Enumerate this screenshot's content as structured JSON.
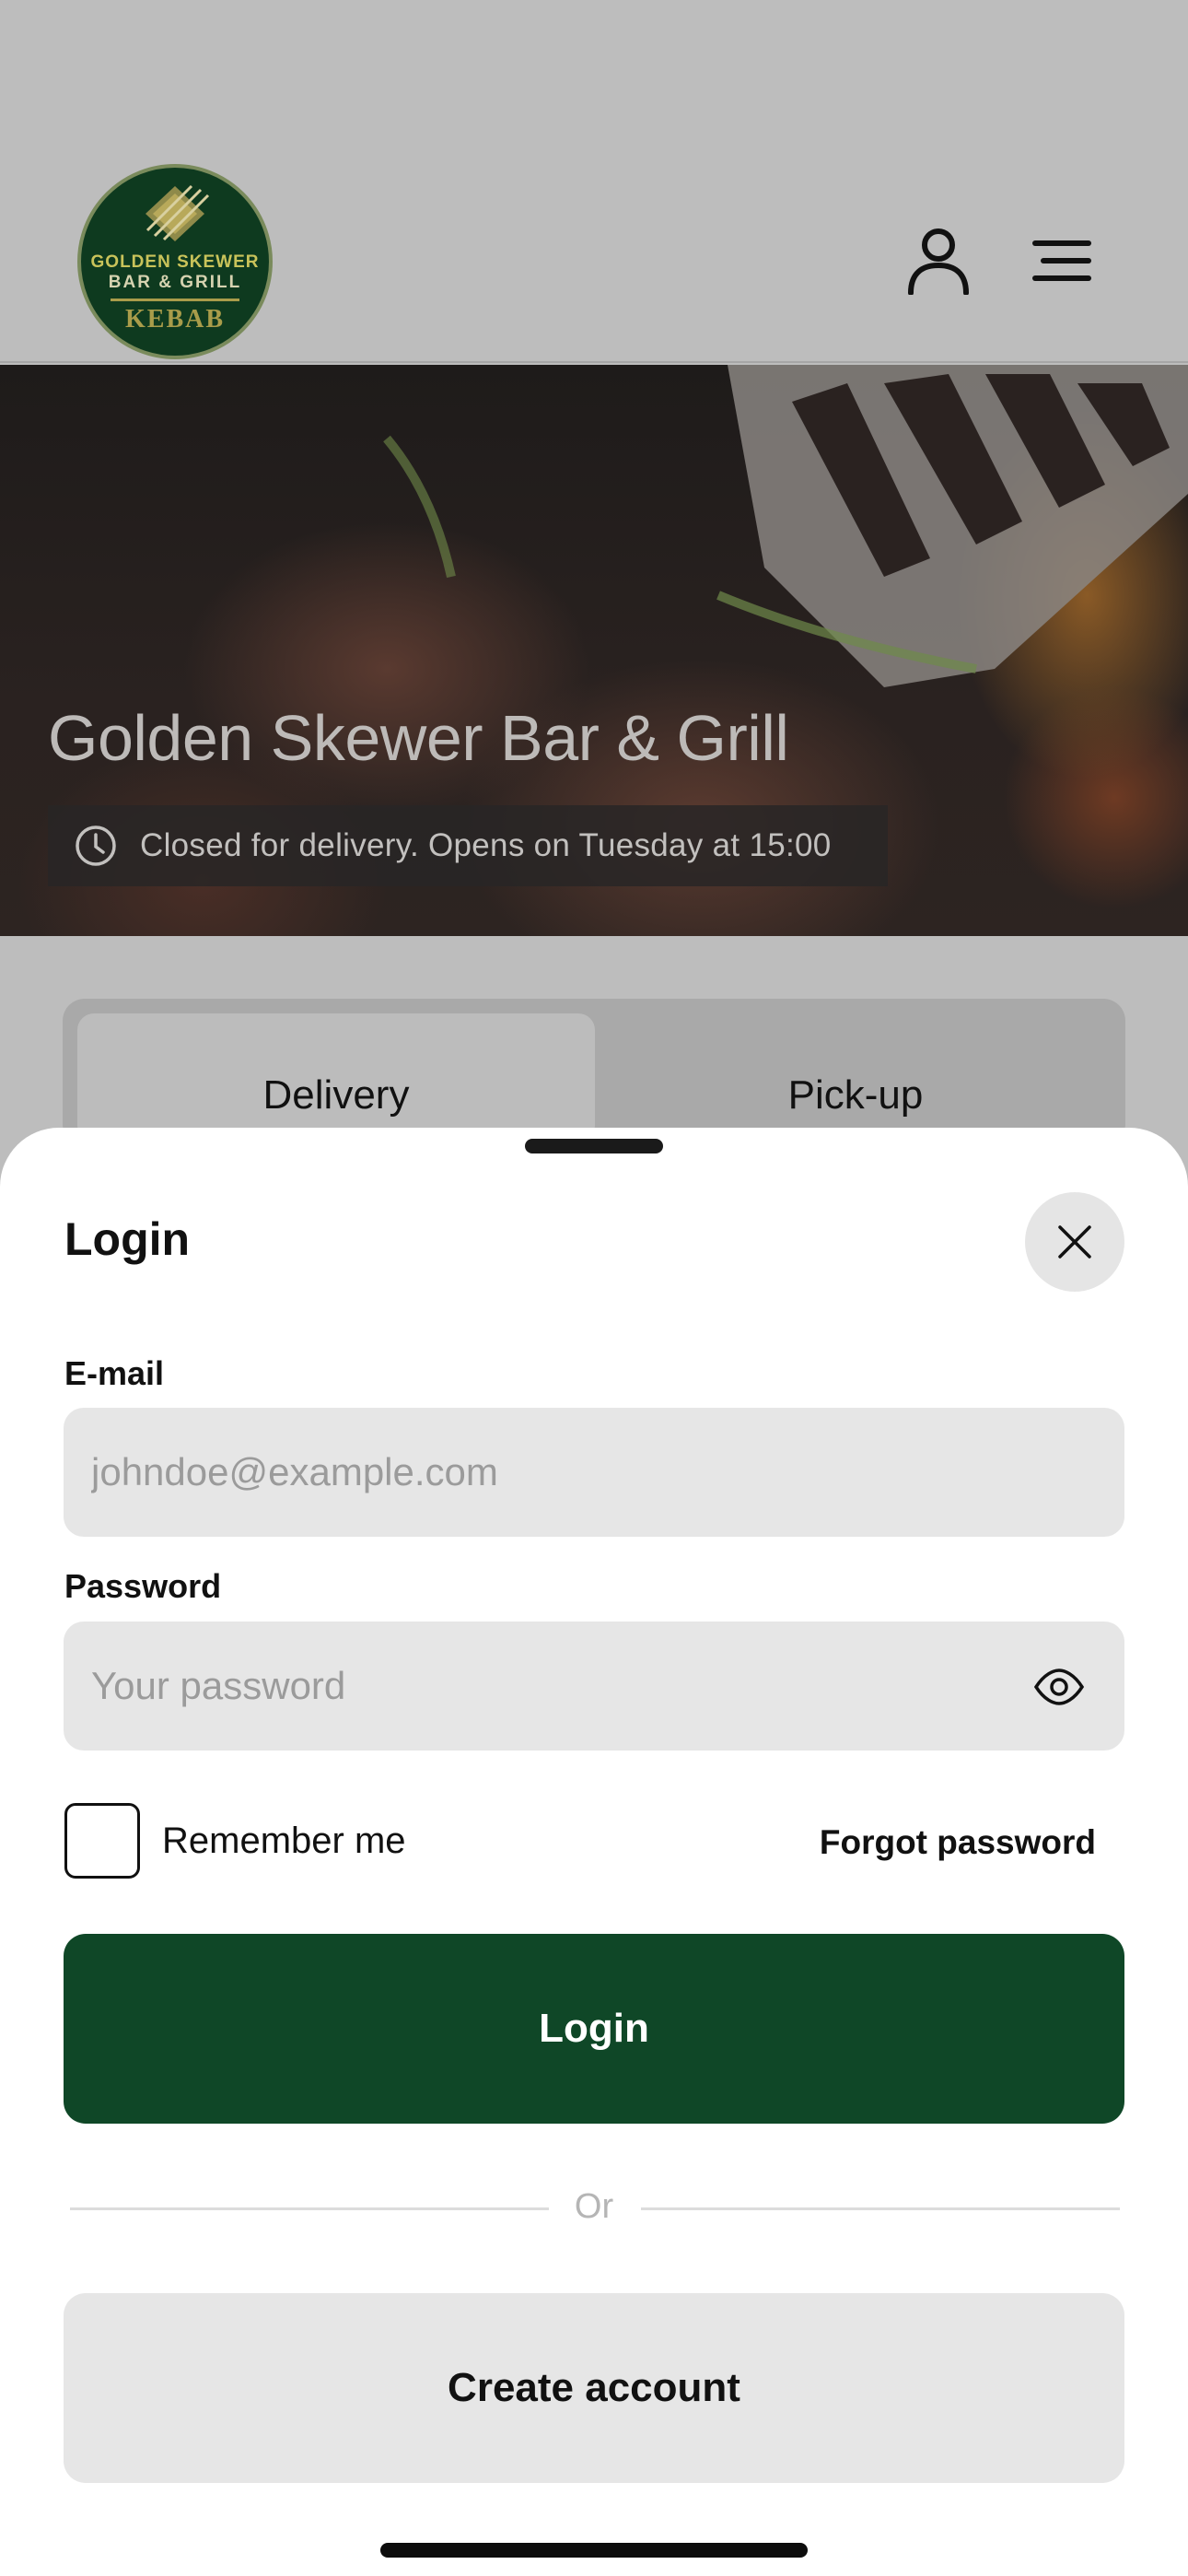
{
  "header": {
    "logo": {
      "line1": "GOLDEN SKEWER",
      "line2": "BAR & GRILL",
      "line3": "KEBAB"
    },
    "icons": [
      "user-icon",
      "menu-icon"
    ]
  },
  "hero": {
    "title": "Golden Skewer Bar & Grill",
    "status_icon": "clock-icon",
    "status_text": "Closed for delivery. Opens on Tuesday at 15:00"
  },
  "tabs": [
    {
      "label": "Delivery",
      "selected": true
    },
    {
      "label": "Pick-up",
      "selected": false
    }
  ],
  "login_sheet": {
    "title": "Login",
    "email": {
      "label": "E-mail",
      "placeholder": "johndoe@example.com",
      "value": ""
    },
    "password": {
      "label": "Password",
      "placeholder": "Your password",
      "value": ""
    },
    "remember_label": "Remember me",
    "remember_checked": false,
    "forgot_label": "Forgot password",
    "login_label": "Login",
    "or_label": "Or",
    "create_label": "Create account"
  },
  "colors": {
    "primary_button": "#0f4727",
    "secondary_button": "#e6e6e6",
    "input_bg": "#e6e6e6",
    "overlay_dim": "#bdbdbd"
  }
}
